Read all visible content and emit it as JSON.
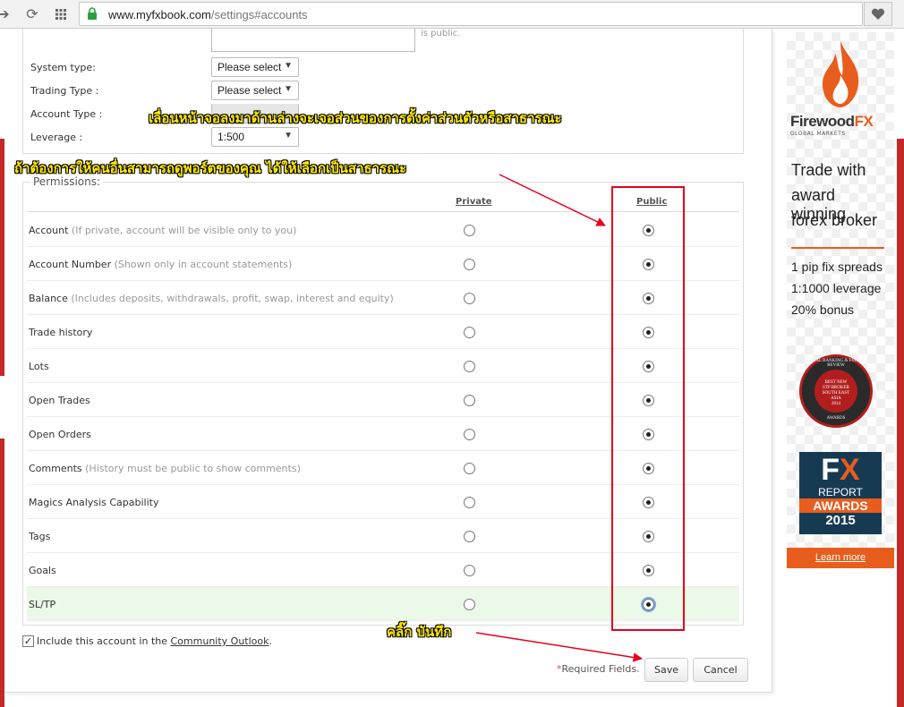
{
  "browser": {
    "url_host": "www.myfxbook.com",
    "url_path": "/settings#accounts"
  },
  "form": {
    "is_public_text": "is public.",
    "fields": [
      {
        "label": "System type:",
        "value": "Please select"
      },
      {
        "label": "Trading Type :",
        "value": "Please select"
      },
      {
        "label": "Account Type :",
        "value": ""
      },
      {
        "label": "Leverage :",
        "value": "1:500"
      }
    ]
  },
  "permissions": {
    "legend": "Permissions:",
    "col_private": "Private",
    "col_public": "Public",
    "rows": [
      {
        "label": "Account",
        "hint": "(If private, account will be visible only to you)",
        "selected": "public"
      },
      {
        "label": "Account Number",
        "hint": "(Shown only in account statements)",
        "selected": "public"
      },
      {
        "label": "Balance",
        "hint": "(Includes deposits, withdrawals, profit, swap, interest and equity)",
        "selected": "public"
      },
      {
        "label": "Trade history",
        "hint": "",
        "selected": "public"
      },
      {
        "label": "Lots",
        "hint": "",
        "selected": "public"
      },
      {
        "label": "Open Trades",
        "hint": "",
        "selected": "public"
      },
      {
        "label": "Open Orders",
        "hint": "",
        "selected": "public"
      },
      {
        "label": "Comments",
        "hint": "(History must be public to show comments)",
        "selected": "public"
      },
      {
        "label": "Magics Analysis Capability",
        "hint": "",
        "selected": "public"
      },
      {
        "label": "Tags",
        "hint": "",
        "selected": "public"
      },
      {
        "label": "Goals",
        "hint": "",
        "selected": "public"
      },
      {
        "label": "SL/TP",
        "hint": "",
        "selected": "public",
        "highlighted": true
      }
    ]
  },
  "footer": {
    "include_checked": true,
    "include_prefix": "Include this account in the ",
    "include_link": "Community Outlook",
    "include_suffix": ".",
    "required_star": "*",
    "required_text": "Required Fields.",
    "save_label": "Save",
    "cancel_label": "Cancel"
  },
  "annotations": {
    "scroll_note": "เลื่อนหน้าจอลงมาด้านล่างจะเจอส่วนของการตั้งค่าส่วนตัวหรือสาธารณะ",
    "public_note": "ถ้าต้องการให้คนอื่นสามารถดูพอร์ตของคุณ ได้ให้เลือกเป็นสาธารณะ",
    "save_note": "คลิ๊ก บันทึก",
    "annotation_color": "#e8001c",
    "text_color": "#ffea00"
  },
  "ad": {
    "brand_main": "Firewood",
    "brand_fx": "FX",
    "brand_sub": "GLOBAL MARKETS",
    "tagline": [
      "Trade with",
      "award winning",
      "forex broker"
    ],
    "points": [
      "1 pip fix spreads",
      "1:1000 leverage",
      "20% bonus"
    ],
    "seal_ring": "GLOBAL BANKING & FINANCE REVIEW",
    "seal_lines": [
      "BEST NEW",
      "STP BROKER",
      "SOUTH EAST",
      "ASIA",
      "2014"
    ],
    "seal_bottom": "AWARDS",
    "fx_big_f": "F",
    "fx_big_x": "X",
    "fx_report": "REPORT",
    "fx_awards": "AWARDS",
    "fx_year": "2015",
    "learn_more": "Learn more",
    "accent": "#e85d1e"
  }
}
